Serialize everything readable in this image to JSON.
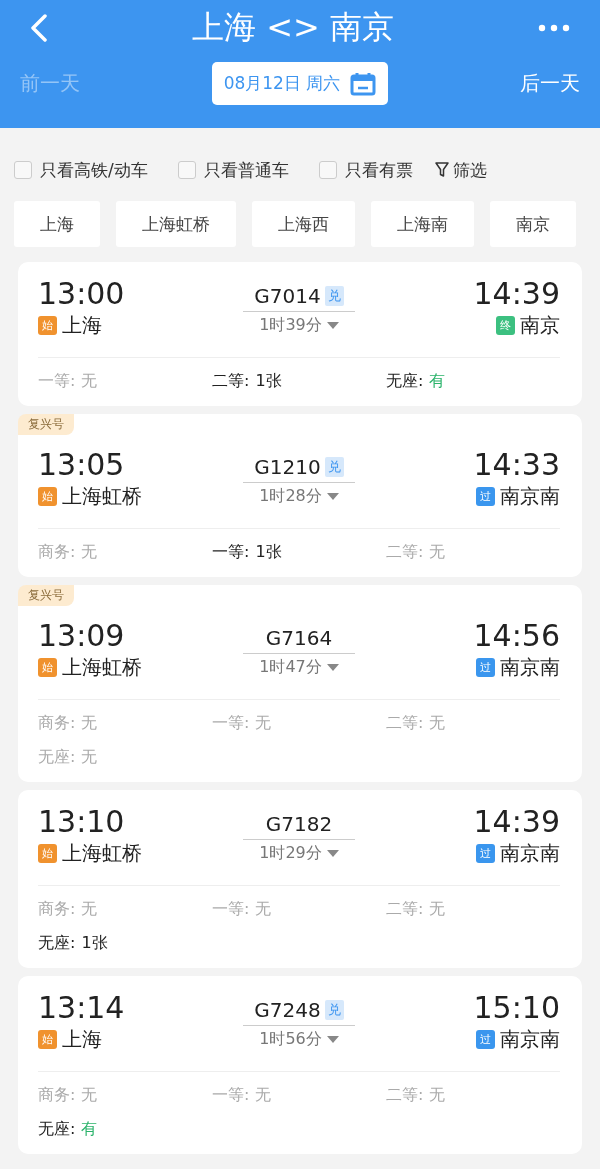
{
  "header": {
    "title": "上海 <> 南京",
    "prev_day": {
      "label": "前一天",
      "disabled": true
    },
    "date": "08月12日 周六",
    "next_day": {
      "label": "后一天",
      "disabled": false
    }
  },
  "filters": [
    {
      "label": "只看高铁/动车",
      "checked": false
    },
    {
      "label": "只看普通车",
      "checked": false
    },
    {
      "label": "只看有票",
      "checked": false
    }
  ],
  "filter_button": "筛选",
  "stations": [
    "上海",
    "上海虹桥",
    "上海西",
    "上海南",
    "南京"
  ],
  "trains": [
    {
      "depart": "13:00",
      "from_badge": {
        "text": "始",
        "color": "#f0922e"
      },
      "from": "上海",
      "number": "G7014",
      "tag": "兑",
      "duration": "1时39分",
      "arrive": "14:39",
      "to_badge": {
        "text": "终",
        "color": "#3cc080"
      },
      "to": "南京",
      "seats": [
        {
          "name": "一等:",
          "value": "无",
          "available": false,
          "highlight": false
        },
        {
          "name": "二等:",
          "value": "1张",
          "available": true,
          "highlight": false
        },
        {
          "name": "无座:",
          "value": "有",
          "available": true,
          "highlight": true
        }
      ]
    },
    {
      "label": "复兴号",
      "depart": "13:05",
      "from_badge": {
        "text": "始",
        "color": "#f0922e"
      },
      "from": "上海虹桥",
      "number": "G1210",
      "tag": "兑",
      "duration": "1时28分",
      "arrive": "14:33",
      "to_badge": {
        "text": "过",
        "color": "#3a96ee"
      },
      "to": "南京南",
      "seats": [
        {
          "name": "商务:",
          "value": "无",
          "available": false,
          "highlight": false
        },
        {
          "name": "一等:",
          "value": "1张",
          "available": true,
          "highlight": false
        },
        {
          "name": "二等:",
          "value": "无",
          "available": false,
          "highlight": false
        }
      ]
    },
    {
      "label": "复兴号",
      "depart": "13:09",
      "from_badge": {
        "text": "始",
        "color": "#f0922e"
      },
      "from": "上海虹桥",
      "number": "G7164",
      "duration": "1时47分",
      "arrive": "14:56",
      "to_badge": {
        "text": "过",
        "color": "#3a96ee"
      },
      "to": "南京南",
      "seats": [
        {
          "name": "商务:",
          "value": "无",
          "available": false,
          "highlight": false
        },
        {
          "name": "一等:",
          "value": "无",
          "available": false,
          "highlight": false
        },
        {
          "name": "二等:",
          "value": "无",
          "available": false,
          "highlight": false
        },
        {
          "name": "无座:",
          "value": "无",
          "available": false,
          "highlight": false
        }
      ]
    },
    {
      "depart": "13:10",
      "from_badge": {
        "text": "始",
        "color": "#f0922e"
      },
      "from": "上海虹桥",
      "number": "G7182",
      "duration": "1时29分",
      "arrive": "14:39",
      "to_badge": {
        "text": "过",
        "color": "#3a96ee"
      },
      "to": "南京南",
      "seats": [
        {
          "name": "商务:",
          "value": "无",
          "available": false,
          "highlight": false
        },
        {
          "name": "一等:",
          "value": "无",
          "available": false,
          "highlight": false
        },
        {
          "name": "二等:",
          "value": "无",
          "available": false,
          "highlight": false
        },
        {
          "name": "无座:",
          "value": "1张",
          "available": true,
          "highlight": false
        }
      ]
    },
    {
      "depart": "13:14",
      "from_badge": {
        "text": "始",
        "color": "#f0922e"
      },
      "from": "上海",
      "number": "G7248",
      "tag": "兑",
      "duration": "1时56分",
      "arrive": "15:10",
      "to_badge": {
        "text": "过",
        "color": "#3a96ee"
      },
      "to": "南京南",
      "seats": [
        {
          "name": "商务:",
          "value": "无",
          "available": false,
          "highlight": false
        },
        {
          "name": "一等:",
          "value": "无",
          "available": false,
          "highlight": false
        },
        {
          "name": "二等:",
          "value": "无",
          "available": false,
          "highlight": false
        },
        {
          "name": "无座:",
          "value": "有",
          "available": true,
          "highlight": true
        }
      ]
    }
  ]
}
